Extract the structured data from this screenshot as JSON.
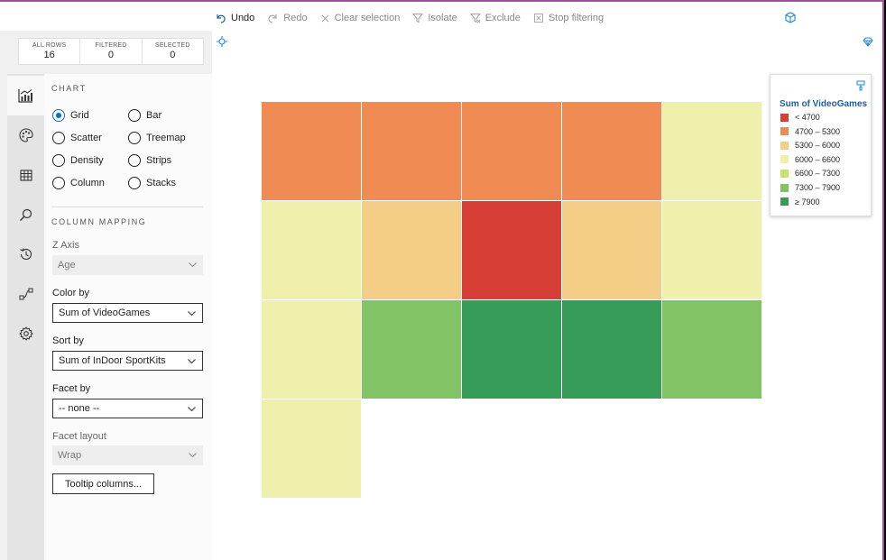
{
  "toolbar": {
    "undo": "Undo",
    "redo": "Redo",
    "clear_selection": "Clear selection",
    "isolate": "Isolate",
    "exclude": "Exclude",
    "stop_filtering": "Stop filtering"
  },
  "counts": [
    {
      "label": "ALL ROWS",
      "value": "16"
    },
    {
      "label": "FILTERED",
      "value": "0"
    },
    {
      "label": "SELECTED",
      "value": "0"
    }
  ],
  "rail": [
    "chart-icon",
    "palette-icon",
    "table-icon",
    "search-icon",
    "history-icon",
    "transform-icon",
    "settings-icon"
  ],
  "chart_section": {
    "title": "CHART",
    "types": [
      "Grid",
      "Bar",
      "Scatter",
      "Treemap",
      "Density",
      "Strips",
      "Column",
      "Stacks"
    ],
    "selected": "Grid"
  },
  "mapping": {
    "title": "COLUMN MAPPING",
    "z_axis": {
      "label": "Z Axis",
      "value": "Age"
    },
    "color_by": {
      "label": "Color by",
      "value": "Sum of VideoGames"
    },
    "sort_by": {
      "label": "Sort by",
      "value": "Sum of InDoor SportKits"
    },
    "facet_by": {
      "label": "Facet by",
      "value": "-- none --"
    },
    "facet_layout": {
      "label": "Facet layout",
      "value": "Wrap"
    },
    "tooltip_button": "Tooltip columns..."
  },
  "legend": {
    "title": "Sum of VideoGames",
    "items": [
      {
        "label": "< 4700",
        "color": "#d73f36"
      },
      {
        "label": "4700 – 5300",
        "color": "#f08c53"
      },
      {
        "label": "5300 – 6000",
        "color": "#f4ce86"
      },
      {
        "label": "6000 – 6600",
        "color": "#eff0ac"
      },
      {
        "label": "6600 – 7300",
        "color": "#c5e07c"
      },
      {
        "label": "7300 – 7900",
        "color": "#82c366"
      },
      {
        "label": "≥ 7900",
        "color": "#369d59"
      }
    ]
  },
  "grid": {
    "columns": 5,
    "cells": [
      {
        "color": "#f08c53"
      },
      {
        "color": "#f08c53"
      },
      {
        "color": "#f08c53"
      },
      {
        "color": "#f08c53"
      },
      {
        "color": "#eff0ac"
      },
      {
        "color": "#eff0ac"
      },
      {
        "color": "#f4ce86"
      },
      {
        "color": "#d73f36"
      },
      {
        "color": "#f4ce86"
      },
      {
        "color": "#eff0ac"
      },
      {
        "color": "#eff0ac"
      },
      {
        "color": "#82c366"
      },
      {
        "color": "#369d59"
      },
      {
        "color": "#369d59"
      },
      {
        "color": "#82c366"
      },
      {
        "color": "#eff0ac"
      }
    ]
  },
  "accent_color": "#0e6ec3"
}
